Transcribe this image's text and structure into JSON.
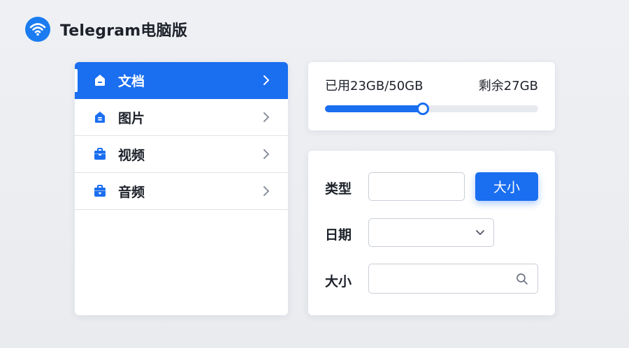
{
  "app": {
    "title": "Telegram电脑版"
  },
  "sidebar": {
    "items": [
      {
        "label": "文档",
        "icon": "document-icon",
        "active": true
      },
      {
        "label": "图片",
        "icon": "image-icon",
        "active": false
      },
      {
        "label": "视频",
        "icon": "video-icon",
        "active": false
      },
      {
        "label": "音频",
        "icon": "audio-icon",
        "active": false
      }
    ]
  },
  "storage": {
    "used_label": "已用23GB/50GB",
    "remaining_label": "剩余27GB",
    "used_fraction": 0.46
  },
  "filters": {
    "type_label": "类型",
    "type_value": "",
    "size_button": "大小",
    "date_label": "日期",
    "date_value": "",
    "size_label": "大小",
    "size_value": ""
  },
  "colors": {
    "accent": "#1a6ef0",
    "logo": "#1a7cf0"
  }
}
